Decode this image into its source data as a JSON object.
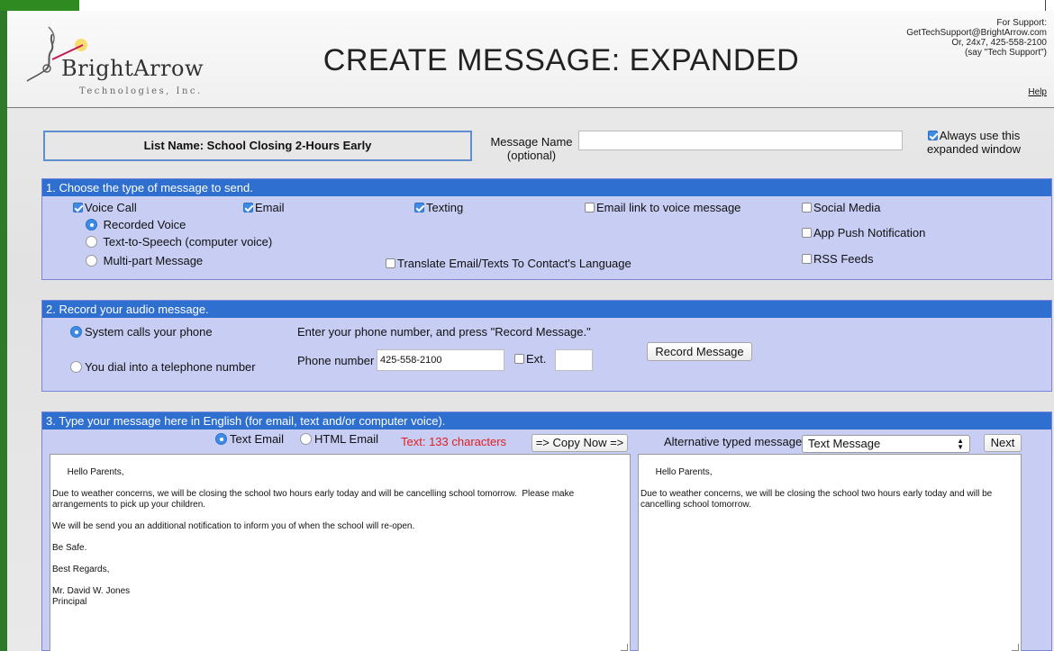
{
  "header": {
    "logo_text": "BrightArrow",
    "logo_sub": "Technologies, Inc.",
    "title": "CREATE MESSAGE: EXPANDED",
    "support_lines": [
      "For Support:",
      "GetTechSupport@BrightArrow.com",
      "Or, 24x7, 425-558-2100",
      "(say \"Tech Support\")"
    ],
    "help": "Help"
  },
  "top": {
    "list_name": "List Name: School Closing 2-Hours Early",
    "message_name_label": "Message Name",
    "message_name_optional": "(optional)",
    "message_name_value": "",
    "always_use": "Always use this expanded window",
    "always_use_checked": true
  },
  "section1": {
    "header": "1. Choose the type of message to send.",
    "voice_call": "Voice Call",
    "email": "Email",
    "texting": "Texting",
    "email_link": "Email link to voice message",
    "social_media": "Social Media",
    "app_push": "App Push Notification",
    "rss": "RSS Feeds",
    "recorded_voice": "Recorded Voice",
    "tts": "Text-to-Speech (computer voice)",
    "multipart": "Multi-part Message",
    "translate": "Translate Email/Texts To Contact's Language"
  },
  "section2": {
    "header": "2. Record your audio message.",
    "system_calls": "System calls your phone",
    "you_dial": "You dial into a telephone number",
    "instructions": "Enter your phone number, and press \"Record Message.\"",
    "phone_label": "Phone number",
    "phone_value": "425-558-2100",
    "ext_label": "Ext.",
    "ext_value": "",
    "record_button": "Record Message"
  },
  "section3": {
    "header": "3. Type your message here in English (for email, text and/or computer voice).",
    "text_email": "Text Email",
    "html_email": "HTML Email",
    "char_count": "Text: 133 characters",
    "copy_now": "=> Copy Now =>",
    "alt_label": "Alternative typed message",
    "alt_select": "Text Message",
    "next": "Next",
    "main_message": "Hello Parents,\n\nDue to weather concerns, we will be closing the school two hours early today and will be cancelling school tomorrow.  Please make arrangements to pick up your children.\n\nWe will be send you an additional notification to inform you of when the school will re-open.\n\nBe Safe.\n\nBest Regards,\n\nMr. David W. Jones\nPrincipal",
    "alt_message": "Hello Parents,\n\nDue to weather concerns, we will be closing the school two hours early today and will be cancelling school tomorrow."
  },
  "colors": {
    "section_header": "#2f6fd0",
    "section_bg": "#c7cdf3",
    "char_count": "#e02020",
    "frame_green": "#2f7a2a"
  }
}
